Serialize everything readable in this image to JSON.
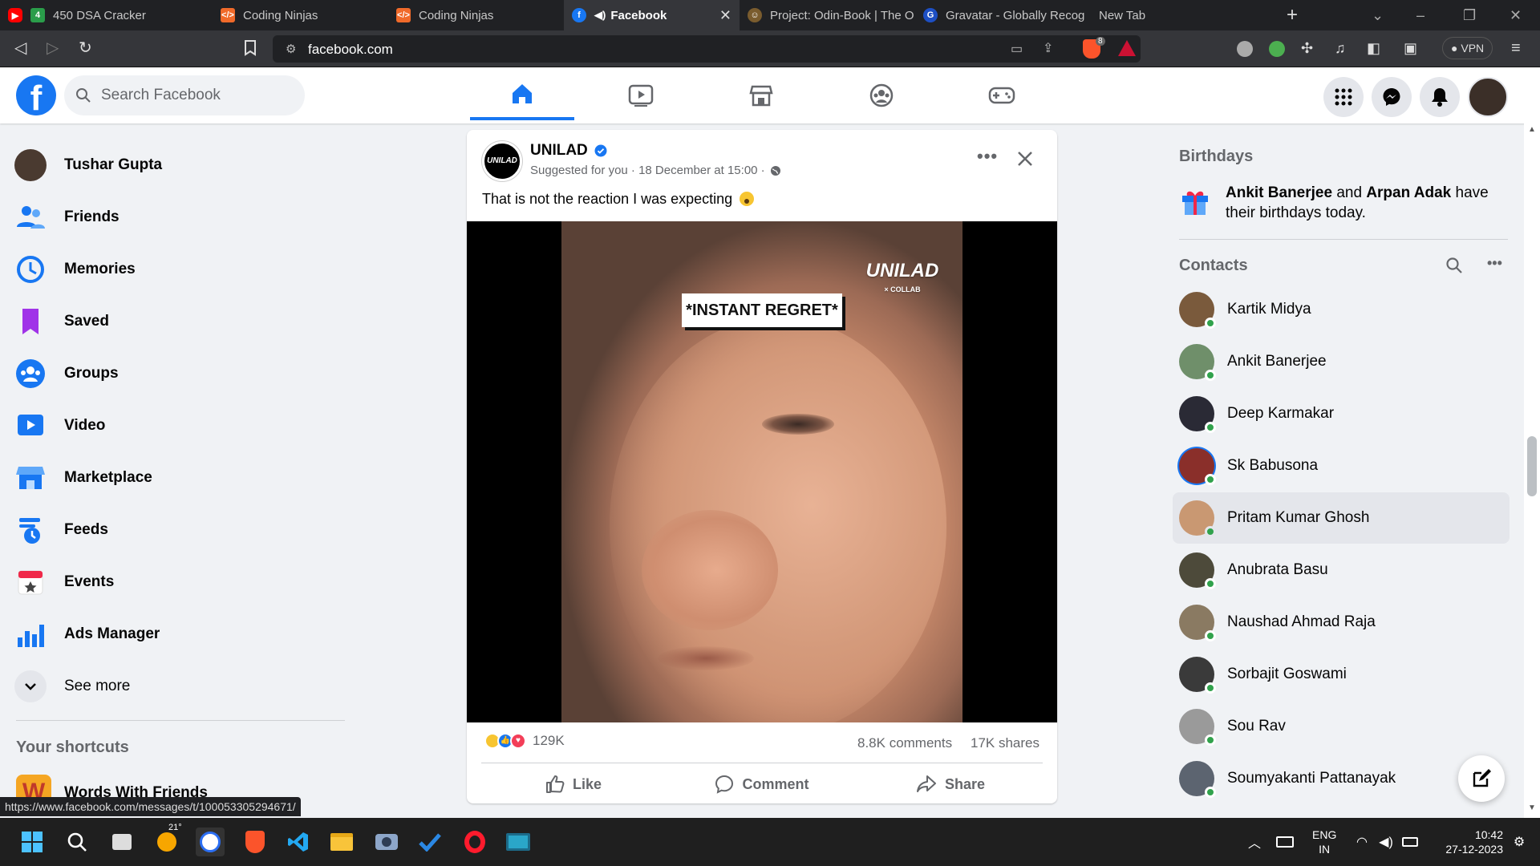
{
  "browser": {
    "tabs": [
      {
        "title": "450 DSA Cracker",
        "icon": "youtube-icon",
        "badge": "4"
      },
      {
        "title": "Coding Ninjas",
        "icon": "coding-ninjas-icon"
      },
      {
        "title": "Coding Ninjas",
        "icon": "coding-ninjas-icon"
      },
      {
        "title": "Facebook",
        "icon": "facebook-icon",
        "active": true
      },
      {
        "title": "Project: Odin-Book | The O",
        "icon": "odin-icon"
      },
      {
        "title": "Gravatar - Globally Recog",
        "icon": "gravatar-icon"
      },
      {
        "title": "New Tab",
        "icon": ""
      }
    ],
    "url": "facebook.com",
    "vpn_label": "VPN",
    "brave_badge": "8",
    "status_url": "https://www.facebook.com/messages/t/100053305294671/"
  },
  "header": {
    "search_placeholder": "Search Facebook",
    "accent": "#1877f2"
  },
  "left_sidebar": {
    "profile_name": "Tushar Gupta",
    "items": [
      {
        "label": "Friends",
        "icon": "friends-icon"
      },
      {
        "label": "Memories",
        "icon": "memories-icon"
      },
      {
        "label": "Saved",
        "icon": "saved-icon"
      },
      {
        "label": "Groups",
        "icon": "groups-icon"
      },
      {
        "label": "Video",
        "icon": "video-icon"
      },
      {
        "label": "Marketplace",
        "icon": "marketplace-icon"
      },
      {
        "label": "Feeds",
        "icon": "feeds-icon"
      },
      {
        "label": "Events",
        "icon": "events-icon"
      },
      {
        "label": "Ads Manager",
        "icon": "ads-manager-icon"
      }
    ],
    "see_more": "See more",
    "shortcuts_heading": "Your shortcuts",
    "shortcut_first": "Words With Friends"
  },
  "post": {
    "page_name": "UNILAD",
    "avatar_text": "UNILAD",
    "meta": "Suggested for you · 18 December at 15:00 ·",
    "text": "That is not the reaction I was expecting",
    "video_caption": "*INSTANT REGRET*",
    "watermark": "UNILAD",
    "watermark_sub": "COLLAB",
    "reaction_count": "129K",
    "comments": "8.8K comments",
    "shares": "17K shares",
    "actions": {
      "like": "Like",
      "comment": "Comment",
      "share": "Share"
    }
  },
  "right_sidebar": {
    "birthdays_heading": "Birthdays",
    "birthday_name_1": "Ankit Banerjee",
    "birthday_and": " and ",
    "birthday_name_2": "Arpan Adak",
    "birthday_suffix": " have their birthdays today.",
    "contacts_heading": "Contacts",
    "contacts": [
      "Kartik Midya",
      "Ankit Banerjee",
      "Deep Karmakar",
      "Sk Babusona",
      "Pritam Kumar Ghosh",
      "Anubrata Basu",
      "Naushad Ahmad Raja",
      "Sorbajit Goswami",
      "Sou Rav",
      "Soumyakanti Pattanayak"
    ]
  },
  "taskbar": {
    "weather": "21°",
    "lang_top": "ENG",
    "lang_bottom": "IN",
    "time": "10:42",
    "date": "27-12-2023"
  }
}
